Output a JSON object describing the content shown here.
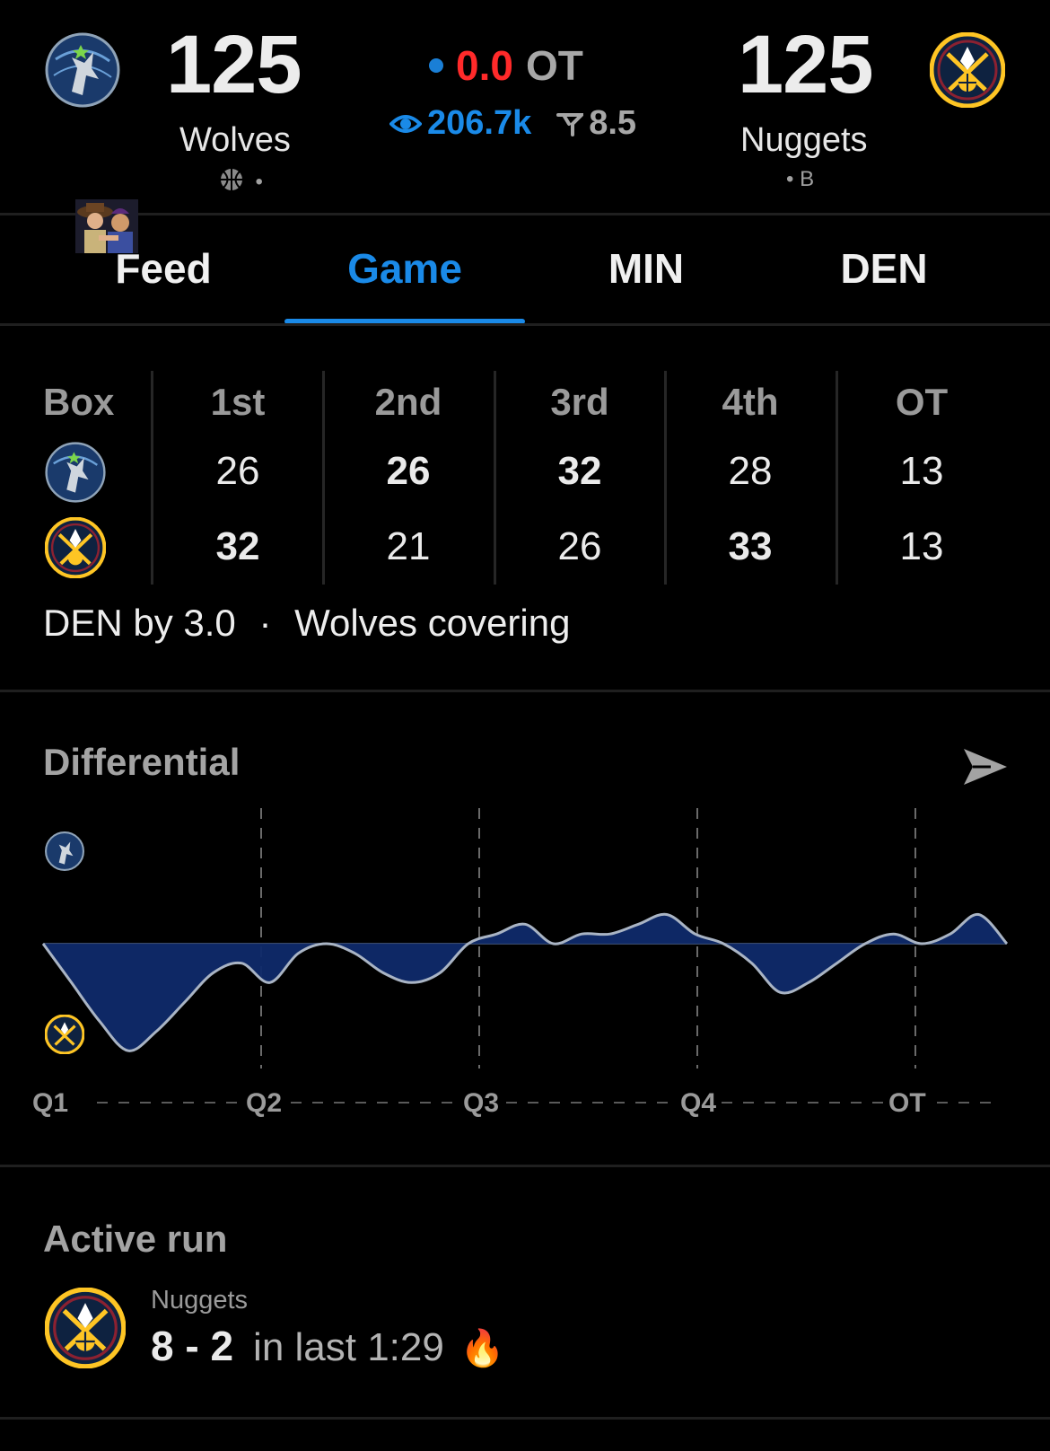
{
  "header": {
    "home": {
      "name": "Wolves",
      "score": "125",
      "indicator": "•"
    },
    "away": {
      "name": "Nuggets",
      "score": "125",
      "indicator": "• B"
    },
    "clock": "0.0",
    "period": "OT",
    "viewers": "206.7k",
    "line": "8.5"
  },
  "tabs": [
    "Feed",
    "Game",
    "MIN",
    "DEN"
  ],
  "active_tab": "Game",
  "box": {
    "header": [
      "Box",
      "1st",
      "2nd",
      "3rd",
      "4th",
      "OT"
    ],
    "rows": [
      {
        "team": "MIN",
        "scores": [
          "26",
          "26",
          "32",
          "28",
          "13"
        ]
      },
      {
        "team": "DEN",
        "scores": [
          "32",
          "21",
          "26",
          "33",
          "13"
        ]
      }
    ],
    "summary_left": "DEN by 3.0",
    "summary_sep": "·",
    "summary_right": "Wolves covering"
  },
  "differential": {
    "title": "Differential",
    "axis_labels": [
      "Q1",
      "Q2",
      "Q3",
      "Q4",
      "OT"
    ]
  },
  "chart_data": {
    "type": "area",
    "title": "Differential",
    "x_labels": [
      "Q1",
      "Q2",
      "Q3",
      "Q4",
      "OT"
    ],
    "series": [
      {
        "values": [
          0,
          -4,
          -8,
          -11,
          -9,
          -6,
          -3,
          -2,
          -4,
          -1,
          0,
          -1,
          -3,
          -4,
          -3,
          0,
          1,
          2,
          0,
          1,
          1,
          2,
          3,
          1,
          0,
          -2,
          -5,
          -4,
          -2,
          0,
          1,
          0,
          1,
          3,
          0
        ]
      }
    ],
    "ylim": [
      -12,
      12
    ],
    "colors": {
      "fill": "#0f2a6a",
      "line": "#a9b4c4"
    }
  },
  "active_run": {
    "title": "Active run",
    "team": "Nuggets",
    "score": "8 - 2",
    "period": "in last 1:29",
    "emoji": "🔥"
  },
  "colors": {
    "accent": "#1a8ae8",
    "clock": "#ff2a2a"
  }
}
